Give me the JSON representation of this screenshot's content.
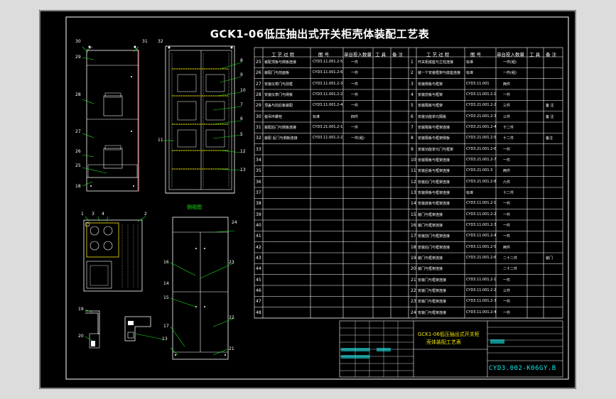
{
  "drawing": {
    "title": "GCK1-06低压抽出式开关柜壳体装配工艺表",
    "front_view_label": "侧视图",
    "title_block_name_line1": "GCK1-06低压抽出式开关柜",
    "title_block_name_line2": "壳体装配工艺表",
    "drawing_number": "CYD3.002-K06GY.B",
    "part_numbers_left_cabinet": [
      "30",
      "31",
      "29",
      "28",
      "27",
      "26",
      "25",
      "18"
    ],
    "part_numbers_frame": [
      "32",
      "8",
      "9",
      "10",
      "7",
      "6",
      "5",
      "11",
      "12",
      "13"
    ],
    "part_numbers_bottom": [
      "1",
      "3",
      "4",
      "2",
      "24",
      "16",
      "23",
      "14",
      "15",
      "22",
      "17",
      "21",
      "19",
      "20",
      "13"
    ]
  },
  "table": {
    "headers_left": [
      "工 艺 过 程",
      "图 号",
      "单台投入数量",
      "工 具",
      "备 注"
    ],
    "headers_right": [
      "工 艺 过 程",
      "图 号",
      "单台投入数量",
      "工 具",
      "备 注"
    ],
    "left_rows": [
      {
        "n": "25",
        "proc": "装配顶板与侧板连接",
        "code": "CYD3.11.001.2-5",
        "qty": "一件"
      },
      {
        "n": "26",
        "proc": "装配门与前面板",
        "code": "CYD3.11.001.2-6",
        "qty": "一件"
      },
      {
        "n": "27",
        "proc": "安装仪表门与前框",
        "code": "CYD3.11.001.2-3",
        "qty": "一件"
      },
      {
        "n": "28",
        "proc": "安装仪表门与侧板",
        "code": "CYD3.11.001.2-2",
        "qty": "一件"
      },
      {
        "n": "29",
        "proc": "顶盖与前后板装配",
        "code": "CYD3.11.001.2-4",
        "qty": "一件"
      },
      {
        "n": "30",
        "proc": "装吊环螺栓",
        "code": "标准",
        "qty": "四件"
      },
      {
        "n": "31",
        "proc": "装配后门与侧板连接",
        "code": "CYD3.21.001.2-1",
        "qty": "一件"
      },
      {
        "n": "32",
        "proc": "装配 后门与侧板连接",
        "code": "CYD3.11.001.2-2",
        "qty": "一件(组)"
      },
      {
        "n": "33",
        "proc": "",
        "code": "",
        "qty": ""
      },
      {
        "n": "34",
        "proc": "",
        "code": "",
        "qty": ""
      },
      {
        "n": "35",
        "proc": "",
        "code": "",
        "qty": ""
      },
      {
        "n": "36",
        "proc": "",
        "code": "",
        "qty": ""
      },
      {
        "n": "37",
        "proc": "",
        "code": "",
        "qty": ""
      },
      {
        "n": "38",
        "proc": "",
        "code": "",
        "qty": ""
      },
      {
        "n": "39",
        "proc": "",
        "code": "",
        "qty": ""
      },
      {
        "n": "40",
        "proc": "",
        "code": "",
        "qty": ""
      },
      {
        "n": "41",
        "proc": "",
        "code": "",
        "qty": ""
      },
      {
        "n": "42",
        "proc": "",
        "code": "",
        "qty": ""
      },
      {
        "n": "43",
        "proc": "",
        "code": "",
        "qty": ""
      },
      {
        "n": "44",
        "proc": "",
        "code": "",
        "qty": ""
      },
      {
        "n": "45",
        "proc": "",
        "code": "",
        "qty": ""
      },
      {
        "n": "46",
        "proc": "",
        "code": "",
        "qty": ""
      },
      {
        "n": "47",
        "proc": "",
        "code": "",
        "qty": ""
      },
      {
        "n": "48",
        "proc": "",
        "code": "",
        "qty": ""
      }
    ],
    "right_rows": [
      {
        "n": "1",
        "proc": "开关柜底座与立柱连接",
        "code": "标准",
        "qty": "一件(组)",
        "note": ""
      },
      {
        "n": "2",
        "proc": "装一个安装框架与底座连接",
        "code": "标准",
        "qty": "一件(组)",
        "note": ""
      },
      {
        "n": "3",
        "proc": "安装侧板与框架",
        "code": "CYD3.11.001",
        "qty": "两件",
        "note": ""
      },
      {
        "n": "4",
        "proc": "安装前板与框架",
        "code": "CYD3.11.001.2-1",
        "qty": "一件",
        "note": ""
      },
      {
        "n": "5",
        "proc": "安装隔板与框架",
        "code": "CYD3.21.001.2-2",
        "qty": "三件",
        "note": "备 注"
      },
      {
        "n": "6",
        "proc": "安装功能单元隔板",
        "code": "CYD3.21.001.2-3",
        "qty": "三件",
        "note": "备 注"
      },
      {
        "n": "7",
        "proc": "安装隔板与框架连接",
        "code": "CYD3.21.001.2-4",
        "qty": "十二件",
        "note": ""
      },
      {
        "n": "8",
        "proc": "安装隔板与框架侧板",
        "code": "CYD3.21.001.2-5",
        "qty": "十二件",
        "note": "备注"
      },
      {
        "n": "9",
        "proc": "安装功能单元门与框架",
        "code": "CYD3.21.001.2-6",
        "qty": "一件",
        "note": ""
      },
      {
        "n": "10",
        "proc": "安装隔板与框架连接",
        "code": "CYD3.21.001.2-7",
        "qty": "一件",
        "note": ""
      },
      {
        "n": "11",
        "proc": "安装后板与框架连接",
        "code": "CYD3.21.001.3",
        "qty": "两件",
        "note": ""
      },
      {
        "n": "12",
        "proc": "安装后门与框架连接",
        "code": "CYD3.21.001.2-8",
        "qty": "六件",
        "note": ""
      },
      {
        "n": "13",
        "proc": "安装侧板与框架连接",
        "code": "标准",
        "qty": "十二件",
        "note": ""
      },
      {
        "n": "14",
        "proc": "安装底板与框架连接",
        "code": "CYD3.11.001.2-1",
        "qty": "一件",
        "note": ""
      },
      {
        "n": "15",
        "proc": "装门与框架连接",
        "code": "CYD3.11.001.2-2",
        "qty": "一件",
        "note": ""
      },
      {
        "n": "16",
        "proc": "装门与框架连接",
        "code": "CYD3.11.001.2-3",
        "qty": "一件",
        "note": ""
      },
      {
        "n": "17",
        "proc": "安装前门与框架连接",
        "code": "CYD3.11.001.2-4",
        "qty": "一件",
        "note": ""
      },
      {
        "n": "18",
        "proc": "安装后门与框架连接",
        "code": "CYD3.11.001.2-5",
        "qty": "两件",
        "note": ""
      },
      {
        "n": "19",
        "proc": "装门与框架连接",
        "code": "CYD3.21.001.2-6",
        "qty": "二十二件",
        "note": "装门"
      },
      {
        "n": "20",
        "proc": "装门与框架连接",
        "code": "",
        "qty": "二十二件",
        "note": ""
      },
      {
        "n": "21",
        "proc": "安装门与框架连接",
        "code": "CYD3.11.001.2-1",
        "qty": "一件",
        "note": ""
      },
      {
        "n": "22",
        "proc": "安装门与框架连接",
        "code": "CYD3.11.001.2-2",
        "qty": "三件",
        "note": ""
      },
      {
        "n": "23",
        "proc": "安装门与框架连接",
        "code": "CYD3.11.001.2-3",
        "qty": "一件",
        "note": ""
      },
      {
        "n": "24",
        "proc": "安装门与框架连接",
        "code": "CYD3.11.001.2-4",
        "qty": "一件",
        "note": ""
      }
    ]
  },
  "colors": {
    "background": "#000000",
    "outer": "#dcdcdc",
    "line": "#ffffff",
    "leader": "#19e619",
    "accent": "#f2e600",
    "cyan": "#19e6e6",
    "red": "#e61919"
  }
}
